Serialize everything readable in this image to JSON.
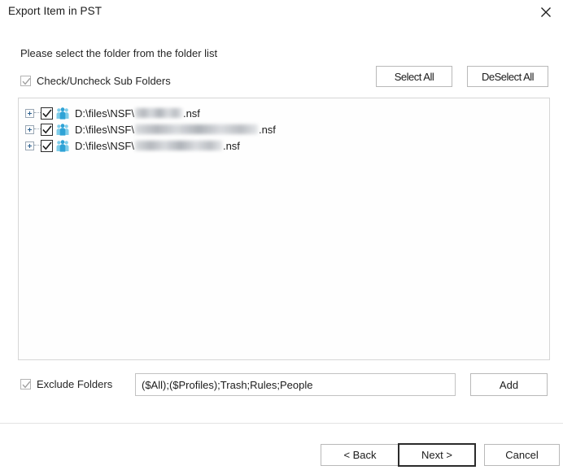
{
  "window": {
    "title": "Export Item in PST",
    "close_icon": "close-icon"
  },
  "content": {
    "prompt": "Please select the folder from the folder list",
    "sub_folders_checkbox": {
      "label": "Check/Uncheck Sub Folders",
      "checked": true
    },
    "select_all_button": "Select All",
    "deselect_all_button": "DeSelect All"
  },
  "folder_tree": {
    "items": [
      {
        "prefix": "D:\\files\\NSF\\",
        "redacted_width": 58,
        "suffix": ".nsf",
        "checked": true,
        "expandable": true,
        "icon": "nsf-database-icon"
      },
      {
        "prefix": "D:\\files\\NSF\\",
        "redacted_width": 151,
        "suffix": ".nsf",
        "checked": true,
        "expandable": true,
        "icon": "nsf-database-icon"
      },
      {
        "prefix": "D:\\files\\NSF\\",
        "redacted_width": 107,
        "suffix": ".nsf",
        "checked": true,
        "expandable": true,
        "icon": "nsf-database-icon"
      }
    ]
  },
  "exclude": {
    "checkbox_label": "Exclude Folders",
    "checked": true,
    "input_value": "($All);($Profiles);Trash;Rules;People",
    "input_placeholder": "",
    "add_button": "Add"
  },
  "footer": {
    "back_button": "< Back",
    "next_button": "Next >",
    "cancel_button": "Cancel"
  },
  "colors": {
    "accent_blue": "#3fa9dc",
    "border_gray": "#b9b9b9",
    "panel_border": "#d6d6d6",
    "text": "#1b1b1b",
    "default_button_border": "#2b2b2b"
  }
}
